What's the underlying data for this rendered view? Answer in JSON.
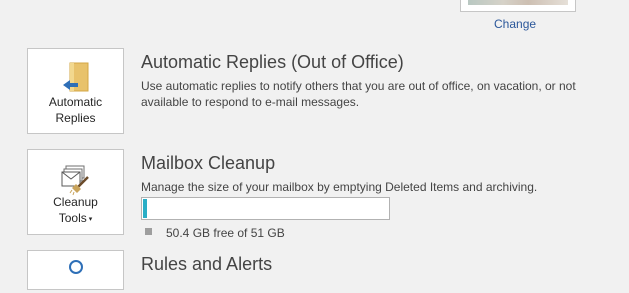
{
  "profile": {
    "change_label": "Change"
  },
  "automatic_replies": {
    "button_line1": "Automatic",
    "button_line2": "Replies",
    "title": "Automatic Replies (Out of Office)",
    "description": "Use automatic replies to notify others that you are out of office, on vacation, or not available to respond to e-mail messages."
  },
  "mailbox_cleanup": {
    "button_line1": "Cleanup",
    "button_line2": "Tools",
    "dropdown_glyph": "▾",
    "title": "Mailbox Cleanup",
    "description": "Manage the size of your mailbox by emptying Deleted Items and archiving.",
    "storage_text": "50.4 GB free of 51 GB",
    "used_fraction": 0.012
  },
  "rules_alerts": {
    "title": "Rules and Alerts"
  },
  "colors": {
    "accent_link": "#2b579a",
    "progress_fill": "#2aaec6",
    "background": "#f1f1f1"
  }
}
